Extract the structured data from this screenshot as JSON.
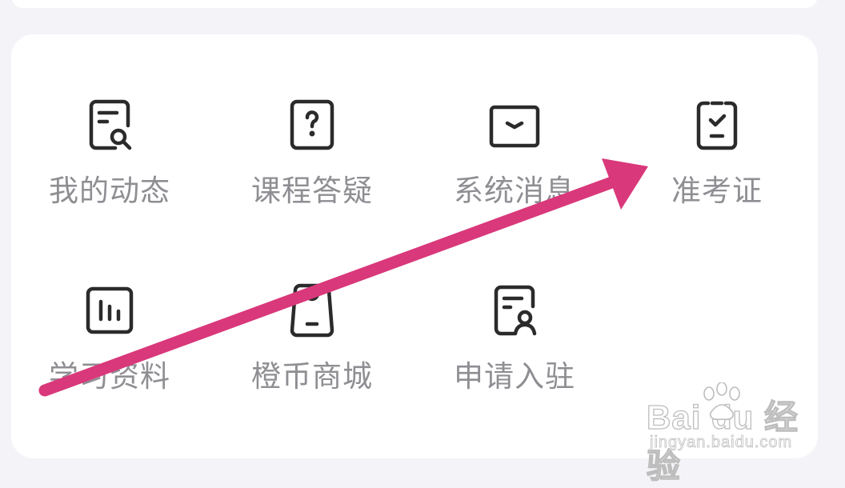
{
  "colors": {
    "background": "#f4f4f8",
    "card": "#ffffff",
    "icon_stroke": "#2b2b2b",
    "label_text": "#8e8e93",
    "arrow": "#d9387a"
  },
  "menu": {
    "items": [
      {
        "label": "我的动态",
        "icon": "document-search-icon"
      },
      {
        "label": "课程答疑",
        "icon": "question-icon"
      },
      {
        "label": "系统消息",
        "icon": "envelope-icon"
      },
      {
        "label": "准考证",
        "icon": "clipboard-check-icon"
      },
      {
        "label": "学习资料",
        "icon": "bar-chart-icon"
      },
      {
        "label": "橙币商城",
        "icon": "shopping-bag-icon"
      },
      {
        "label": "申请入驻",
        "icon": "document-user-icon"
      }
    ]
  },
  "watermark": {
    "brand": "Bai du 经验",
    "url": "jingyan.baidu.com"
  }
}
